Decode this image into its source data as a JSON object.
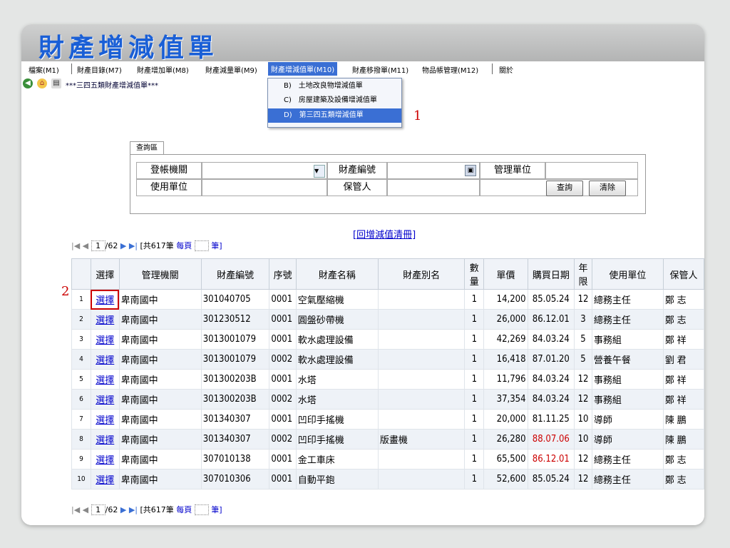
{
  "title": "財產增減值單",
  "menu": {
    "items": [
      "檔案(M1)",
      "財產目錄(M7)",
      "財產增加單(M8)",
      "財產減量單(M9)",
      "財產增減值單(M10)",
      "財產移撥單(M11)",
      "物品帳管理(M12)",
      "關於"
    ],
    "active_index": 4
  },
  "dropdown": {
    "items": [
      "B)　土地改良物增減值單",
      "C)　房屋建築及設備增減值單",
      "D)　第三四五類增減值單"
    ],
    "selected_index": 2
  },
  "toolbar": {
    "breadcrumb": "***三四五類財產增減值單***"
  },
  "annotations": {
    "label1": "1",
    "label2": "2"
  },
  "query": {
    "tab": "查詢區",
    "labels": {
      "dept": "登帳機關",
      "asset_no": "財產編號",
      "mgmt_unit": "管理單位",
      "use_unit": "使用單位",
      "keeper": "保管人"
    },
    "search_button": "查詢",
    "clear_button": "清除"
  },
  "return_link": "[回增減值清冊]",
  "pager": {
    "page": "1",
    "total_pages": "/62",
    "total_text": "[共617筆",
    "per_page_label": "每頁",
    "per_page_unit": "筆]"
  },
  "table": {
    "headers": [
      "選擇",
      "管理機關",
      "財產編號",
      "序號",
      "財產名稱",
      "財產別名",
      "數量",
      "單價",
      "購買日期",
      "年限",
      "使用單位",
      "保管人"
    ],
    "rows": [
      {
        "no": "1",
        "select": "選擇",
        "org": "卑南國中",
        "asset_no": "301040705",
        "seq": "0001",
        "name": "空氣壓縮機",
        "alias": "",
        "qty": "1",
        "price": "14,200",
        "date": "85.05.24",
        "life": "12",
        "unit": "總務主任",
        "keeper": "鄭 志"
      },
      {
        "no": "2",
        "select": "選擇",
        "org": "卑南國中",
        "asset_no": "301230512",
        "seq": "0001",
        "name": "圓盤砂帶機",
        "alias": "",
        "qty": "1",
        "price": "26,000",
        "date": "86.12.01",
        "life": "3",
        "unit": "總務主任",
        "keeper": "鄭 志"
      },
      {
        "no": "3",
        "select": "選擇",
        "org": "卑南國中",
        "asset_no": "3013001079",
        "seq": "0001",
        "name": "軟水處理設備",
        "alias": "",
        "qty": "1",
        "price": "42,269",
        "date": "84.03.24",
        "life": "5",
        "unit": "事務組",
        "keeper": "鄭 祥"
      },
      {
        "no": "4",
        "select": "選擇",
        "org": "卑南國中",
        "asset_no": "3013001079",
        "seq": "0002",
        "name": "軟水處理設備",
        "alias": "",
        "qty": "1",
        "price": "16,418",
        "date": "87.01.20",
        "life": "5",
        "unit": "營養午餐",
        "keeper": "劉 君"
      },
      {
        "no": "5",
        "select": "選擇",
        "org": "卑南國中",
        "asset_no": "301300203B",
        "seq": "0001",
        "name": "水塔",
        "alias": "",
        "qty": "1",
        "price": "11,796",
        "date": "84.03.24",
        "life": "12",
        "unit": "事務組",
        "keeper": "鄭 祥"
      },
      {
        "no": "6",
        "select": "選擇",
        "org": "卑南國中",
        "asset_no": "301300203B",
        "seq": "0002",
        "name": "水塔",
        "alias": "",
        "qty": "1",
        "price": "37,354",
        "date": "84.03.24",
        "life": "12",
        "unit": "事務組",
        "keeper": "鄭 祥"
      },
      {
        "no": "7",
        "select": "選擇",
        "org": "卑南國中",
        "asset_no": "301340307",
        "seq": "0001",
        "name": "凹印手搖機",
        "alias": "",
        "qty": "1",
        "price": "20,000",
        "date": "81.11.25",
        "life": "10",
        "unit": "導師",
        "keeper": "陳 鵬"
      },
      {
        "no": "8",
        "select": "選擇",
        "org": "卑南國中",
        "asset_no": "301340307",
        "seq": "0002",
        "name": "凹印手搖機",
        "alias": "版畫機",
        "qty": "1",
        "price": "26,280",
        "date": "88.07.06",
        "life": "10",
        "unit": "導師",
        "keeper": "陳 鵬",
        "date_red": true
      },
      {
        "no": "9",
        "select": "選擇",
        "org": "卑南國中",
        "asset_no": "307010138",
        "seq": "0001",
        "name": "金工車床",
        "alias": "",
        "qty": "1",
        "price": "65,500",
        "date": "86.12.01",
        "life": "12",
        "unit": "總務主任",
        "keeper": "鄭 志",
        "date_red": true
      },
      {
        "no": "10",
        "select": "選擇",
        "org": "卑南國中",
        "asset_no": "307010306",
        "seq": "0001",
        "name": "自動平鉋",
        "alias": "",
        "qty": "1",
        "price": "52,600",
        "date": "85.05.24",
        "life": "12",
        "unit": "總務主任",
        "keeper": "鄭 志"
      }
    ]
  }
}
